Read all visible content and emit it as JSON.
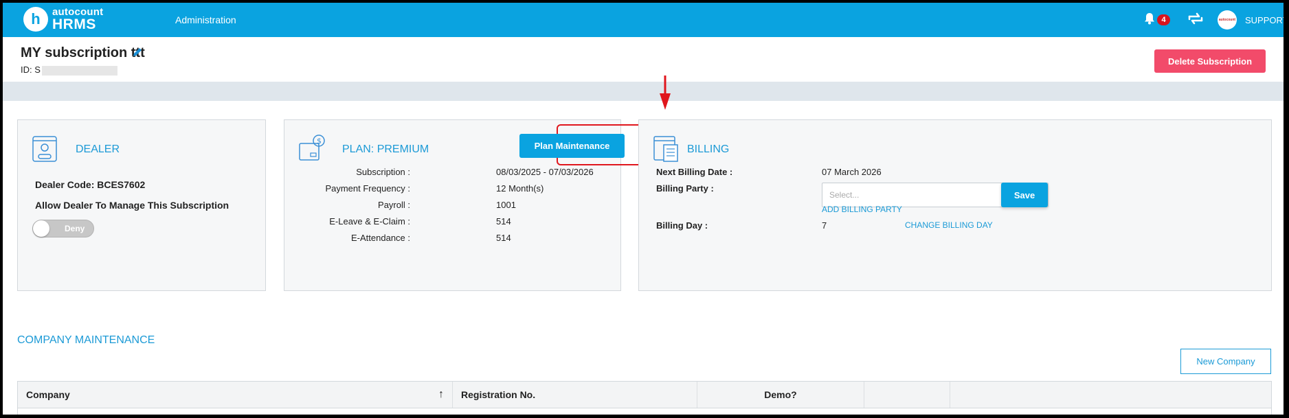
{
  "topbar": {
    "logo_small": "autocount",
    "logo_big": "HRMS",
    "logo_letter": "h",
    "nav_admin": "Administration",
    "notification_count": "4",
    "avatar_text": "autocount",
    "support": "SUPPORT"
  },
  "header": {
    "title": "MY subscription ttt",
    "id_label": "ID: S",
    "delete_button": "Delete Subscription"
  },
  "dealer": {
    "title": "DEALER",
    "code_label": "Dealer Code: BCES7602",
    "allow_label": "Allow Dealer To Manage This Subscription",
    "toggle_label": "Deny"
  },
  "plan": {
    "title": "PLAN: PREMIUM",
    "button": "Plan Maintenance",
    "rows": [
      {
        "label": "Subscription :",
        "value": "08/03/2025 - 07/03/2026"
      },
      {
        "label": "Payment Frequency :",
        "value": "12 Month(s)"
      },
      {
        "label": "Payroll :",
        "value": "1001"
      },
      {
        "label": "E-Leave & E-Claim :",
        "value": "514"
      },
      {
        "label": "E-Attendance :",
        "value": "514"
      }
    ]
  },
  "billing": {
    "title": "BILLING",
    "next_billing_label": "Next Billing Date :",
    "next_billing_value": "07 March 2026",
    "party_label": "Billing Party :",
    "party_placeholder": "Select...",
    "add_party_link": "ADD BILLING PARTY",
    "save_button": "Save",
    "day_label": "Billing Day :",
    "day_value": "7",
    "change_day_link": "CHANGE BILLING DAY"
  },
  "company": {
    "title": "COMPANY MAINTENANCE",
    "new_button": "New Company",
    "columns": [
      "Company",
      "Registration No.",
      "Demo?"
    ],
    "sort_icon": "arrow-up-icon"
  },
  "colors": {
    "brand": "#0aa3e0",
    "danger": "#f24b6a",
    "highlight": "#e0161d"
  }
}
